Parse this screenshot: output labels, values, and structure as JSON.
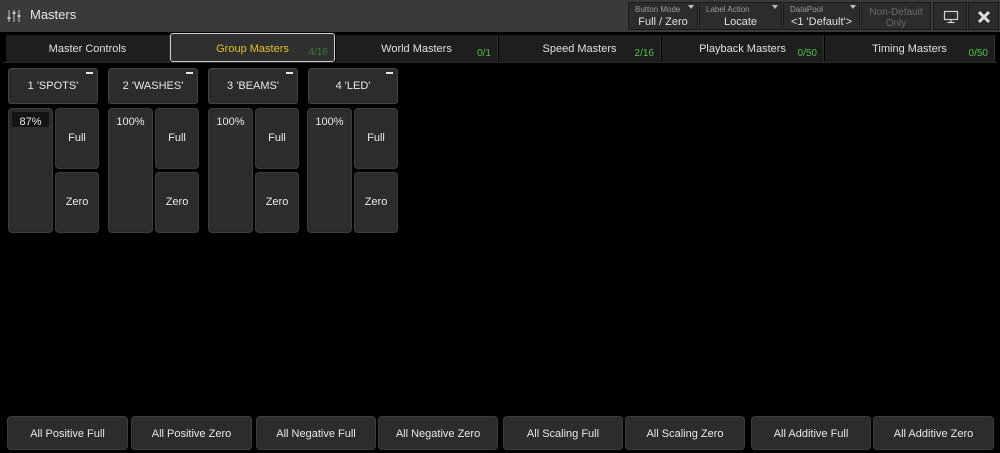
{
  "window": {
    "title": "Masters",
    "icon": "sliders-icon"
  },
  "header": {
    "button_mode": {
      "caption": "Button Mode",
      "value": "Full / Zero"
    },
    "label_action": {
      "caption": "Label Action",
      "value": "Locate"
    },
    "data_pool": {
      "caption": "DataPool",
      "value": "<1 'Default'>"
    },
    "non_default": {
      "caption": "Non-Default",
      "value": "Only"
    },
    "display_icon": "monitor-icon",
    "close_icon": "close-icon"
  },
  "tabs": [
    {
      "label": "Master Controls",
      "count": ""
    },
    {
      "label": "Group Masters",
      "count": "4/16"
    },
    {
      "label": "World Masters",
      "count": "0/1"
    },
    {
      "label": "Speed Masters",
      "count": "2/16"
    },
    {
      "label": "Playback Masters",
      "count": "0/50"
    },
    {
      "label": "Timing Masters",
      "count": "0/50"
    }
  ],
  "active_tab": "Group Masters",
  "groups": [
    {
      "name": "1 'SPOTS'",
      "percent": "87%",
      "level": 0.87,
      "full_label": "Full",
      "zero_label": "Zero"
    },
    {
      "name": "2 'WASHES'",
      "percent": "100%",
      "level": 1.0,
      "full_label": "Full",
      "zero_label": "Zero"
    },
    {
      "name": "3 'BEAMS'",
      "percent": "100%",
      "level": 1.0,
      "full_label": "Full",
      "zero_label": "Zero"
    },
    {
      "name": "4 'LED'",
      "percent": "100%",
      "level": 1.0,
      "full_label": "Full",
      "zero_label": "Zero"
    }
  ],
  "bottom_bar": [
    "All Positive Full",
    "All Positive Zero",
    "All Negative Full",
    "All Negative Zero",
    "All Scaling Full",
    "All Scaling Zero",
    "All Additive Full",
    "All Additive Zero"
  ],
  "colors": {
    "active_tab_text": "#e2c020",
    "count_green": "#53c24a",
    "background": "#000000",
    "panel": "#2c2c2c"
  }
}
